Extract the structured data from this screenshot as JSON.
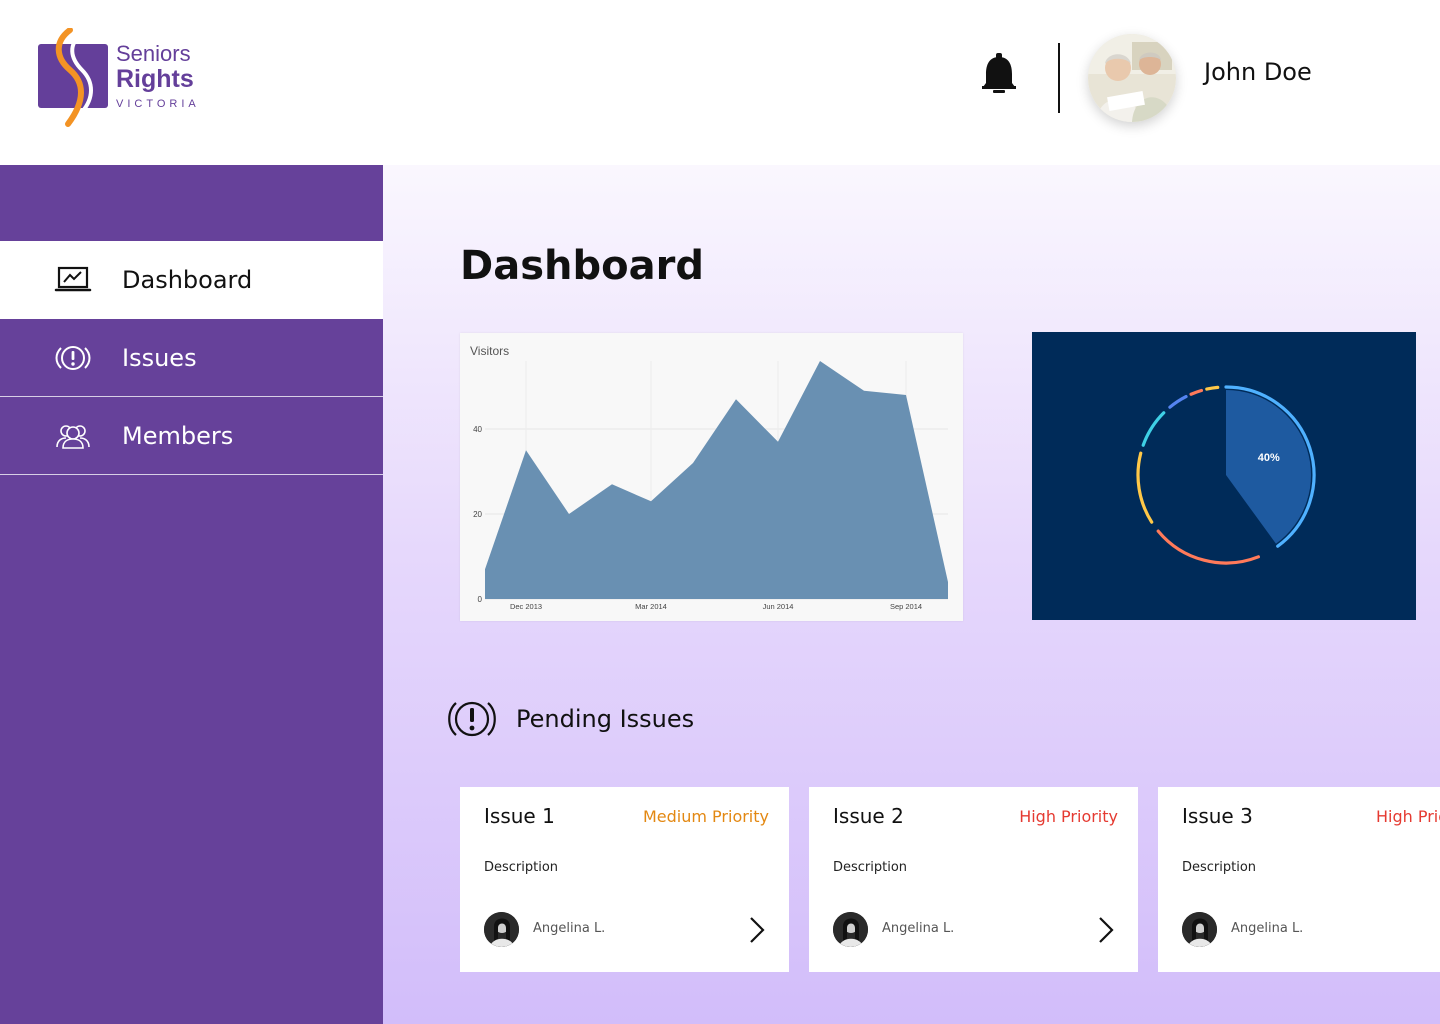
{
  "brand": {
    "line1": "Seniors",
    "line2": "Rights",
    "line3": "VICTORIA",
    "primary_color": "#643f9a",
    "accent_color": "#f39324"
  },
  "header": {
    "notification_icon": "bell-icon",
    "user_name": "John Doe"
  },
  "sidebar": {
    "background": "#66419a",
    "items": [
      {
        "label": "Dashboard",
        "icon": "monitor-chart-icon",
        "active": true
      },
      {
        "label": "Issues",
        "icon": "alert-circle-icon",
        "active": false
      },
      {
        "label": "Members",
        "icon": "group-icon",
        "active": false
      }
    ]
  },
  "main": {
    "title": "Dashboard",
    "pending_title": "Pending Issues"
  },
  "chart_data": [
    {
      "type": "area",
      "ylabel": "Visitors",
      "ylim": [
        0,
        56
      ],
      "y_ticks": [
        "0",
        "20",
        "40"
      ],
      "x_ticks": [
        "Dec 2013",
        "Mar 2014",
        "Jun 2014",
        "Sep 2014"
      ],
      "values": [
        7,
        35,
        20,
        27,
        23,
        32,
        47,
        37,
        56,
        49,
        48,
        4
      ],
      "color": "#6990b2",
      "grid": true
    },
    {
      "type": "pie",
      "slices": [
        {
          "label": "40%",
          "value": 40,
          "color": "#1e5aa0"
        }
      ],
      "ring_colors": [
        "#4fb1ff",
        "#ff7a5a",
        "#ffc848",
        "#3fd0e6",
        "#5584f0",
        "#ff7a5a",
        "#ffc848"
      ],
      "background": "#002b59"
    }
  ],
  "issues": [
    {
      "title": "Issue 1",
      "priority": "Medium Priority",
      "priority_color": "#e38812",
      "description": "Description",
      "assignee": "Angelina L."
    },
    {
      "title": "Issue 2",
      "priority": "High Priority",
      "priority_color": "#e53a31",
      "description": "Description",
      "assignee": "Angelina L."
    },
    {
      "title": "Issue 3",
      "priority": "High Priority",
      "priority_color": "#e53a31",
      "description": "Description",
      "assignee": "Angelina L."
    }
  ]
}
